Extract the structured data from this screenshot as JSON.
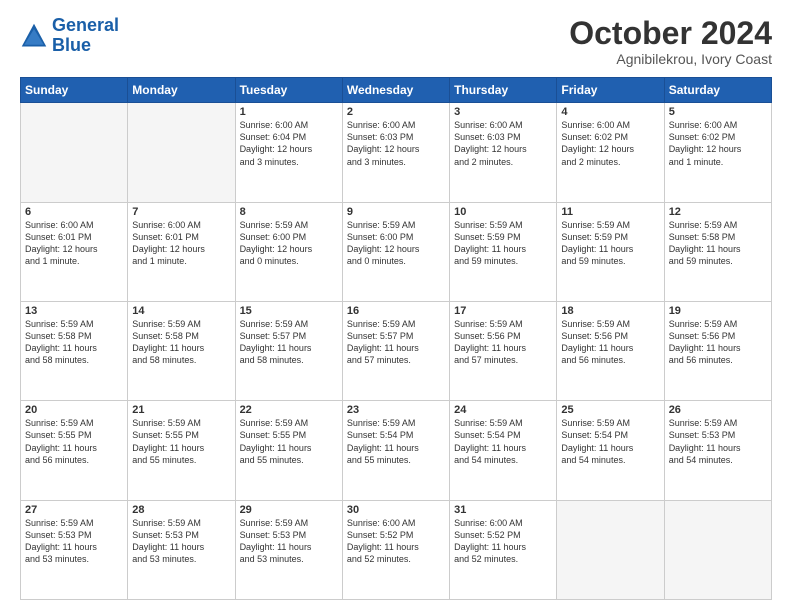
{
  "header": {
    "logo_line1": "General",
    "logo_line2": "Blue",
    "month": "October 2024",
    "location": "Agnibilekrou, Ivory Coast"
  },
  "days_of_week": [
    "Sunday",
    "Monday",
    "Tuesday",
    "Wednesday",
    "Thursday",
    "Friday",
    "Saturday"
  ],
  "weeks": [
    [
      {
        "num": "",
        "info": ""
      },
      {
        "num": "",
        "info": ""
      },
      {
        "num": "1",
        "info": "Sunrise: 6:00 AM\nSunset: 6:04 PM\nDaylight: 12 hours\nand 3 minutes."
      },
      {
        "num": "2",
        "info": "Sunrise: 6:00 AM\nSunset: 6:03 PM\nDaylight: 12 hours\nand 3 minutes."
      },
      {
        "num": "3",
        "info": "Sunrise: 6:00 AM\nSunset: 6:03 PM\nDaylight: 12 hours\nand 2 minutes."
      },
      {
        "num": "4",
        "info": "Sunrise: 6:00 AM\nSunset: 6:02 PM\nDaylight: 12 hours\nand 2 minutes."
      },
      {
        "num": "5",
        "info": "Sunrise: 6:00 AM\nSunset: 6:02 PM\nDaylight: 12 hours\nand 1 minute."
      }
    ],
    [
      {
        "num": "6",
        "info": "Sunrise: 6:00 AM\nSunset: 6:01 PM\nDaylight: 12 hours\nand 1 minute."
      },
      {
        "num": "7",
        "info": "Sunrise: 6:00 AM\nSunset: 6:01 PM\nDaylight: 12 hours\nand 1 minute."
      },
      {
        "num": "8",
        "info": "Sunrise: 5:59 AM\nSunset: 6:00 PM\nDaylight: 12 hours\nand 0 minutes."
      },
      {
        "num": "9",
        "info": "Sunrise: 5:59 AM\nSunset: 6:00 PM\nDaylight: 12 hours\nand 0 minutes."
      },
      {
        "num": "10",
        "info": "Sunrise: 5:59 AM\nSunset: 5:59 PM\nDaylight: 11 hours\nand 59 minutes."
      },
      {
        "num": "11",
        "info": "Sunrise: 5:59 AM\nSunset: 5:59 PM\nDaylight: 11 hours\nand 59 minutes."
      },
      {
        "num": "12",
        "info": "Sunrise: 5:59 AM\nSunset: 5:58 PM\nDaylight: 11 hours\nand 59 minutes."
      }
    ],
    [
      {
        "num": "13",
        "info": "Sunrise: 5:59 AM\nSunset: 5:58 PM\nDaylight: 11 hours\nand 58 minutes."
      },
      {
        "num": "14",
        "info": "Sunrise: 5:59 AM\nSunset: 5:58 PM\nDaylight: 11 hours\nand 58 minutes."
      },
      {
        "num": "15",
        "info": "Sunrise: 5:59 AM\nSunset: 5:57 PM\nDaylight: 11 hours\nand 58 minutes."
      },
      {
        "num": "16",
        "info": "Sunrise: 5:59 AM\nSunset: 5:57 PM\nDaylight: 11 hours\nand 57 minutes."
      },
      {
        "num": "17",
        "info": "Sunrise: 5:59 AM\nSunset: 5:56 PM\nDaylight: 11 hours\nand 57 minutes."
      },
      {
        "num": "18",
        "info": "Sunrise: 5:59 AM\nSunset: 5:56 PM\nDaylight: 11 hours\nand 56 minutes."
      },
      {
        "num": "19",
        "info": "Sunrise: 5:59 AM\nSunset: 5:56 PM\nDaylight: 11 hours\nand 56 minutes."
      }
    ],
    [
      {
        "num": "20",
        "info": "Sunrise: 5:59 AM\nSunset: 5:55 PM\nDaylight: 11 hours\nand 56 minutes."
      },
      {
        "num": "21",
        "info": "Sunrise: 5:59 AM\nSunset: 5:55 PM\nDaylight: 11 hours\nand 55 minutes."
      },
      {
        "num": "22",
        "info": "Sunrise: 5:59 AM\nSunset: 5:55 PM\nDaylight: 11 hours\nand 55 minutes."
      },
      {
        "num": "23",
        "info": "Sunrise: 5:59 AM\nSunset: 5:54 PM\nDaylight: 11 hours\nand 55 minutes."
      },
      {
        "num": "24",
        "info": "Sunrise: 5:59 AM\nSunset: 5:54 PM\nDaylight: 11 hours\nand 54 minutes."
      },
      {
        "num": "25",
        "info": "Sunrise: 5:59 AM\nSunset: 5:54 PM\nDaylight: 11 hours\nand 54 minutes."
      },
      {
        "num": "26",
        "info": "Sunrise: 5:59 AM\nSunset: 5:53 PM\nDaylight: 11 hours\nand 54 minutes."
      }
    ],
    [
      {
        "num": "27",
        "info": "Sunrise: 5:59 AM\nSunset: 5:53 PM\nDaylight: 11 hours\nand 53 minutes."
      },
      {
        "num": "28",
        "info": "Sunrise: 5:59 AM\nSunset: 5:53 PM\nDaylight: 11 hours\nand 53 minutes."
      },
      {
        "num": "29",
        "info": "Sunrise: 5:59 AM\nSunset: 5:53 PM\nDaylight: 11 hours\nand 53 minutes."
      },
      {
        "num": "30",
        "info": "Sunrise: 6:00 AM\nSunset: 5:52 PM\nDaylight: 11 hours\nand 52 minutes."
      },
      {
        "num": "31",
        "info": "Sunrise: 6:00 AM\nSunset: 5:52 PM\nDaylight: 11 hours\nand 52 minutes."
      },
      {
        "num": "",
        "info": ""
      },
      {
        "num": "",
        "info": ""
      }
    ]
  ]
}
